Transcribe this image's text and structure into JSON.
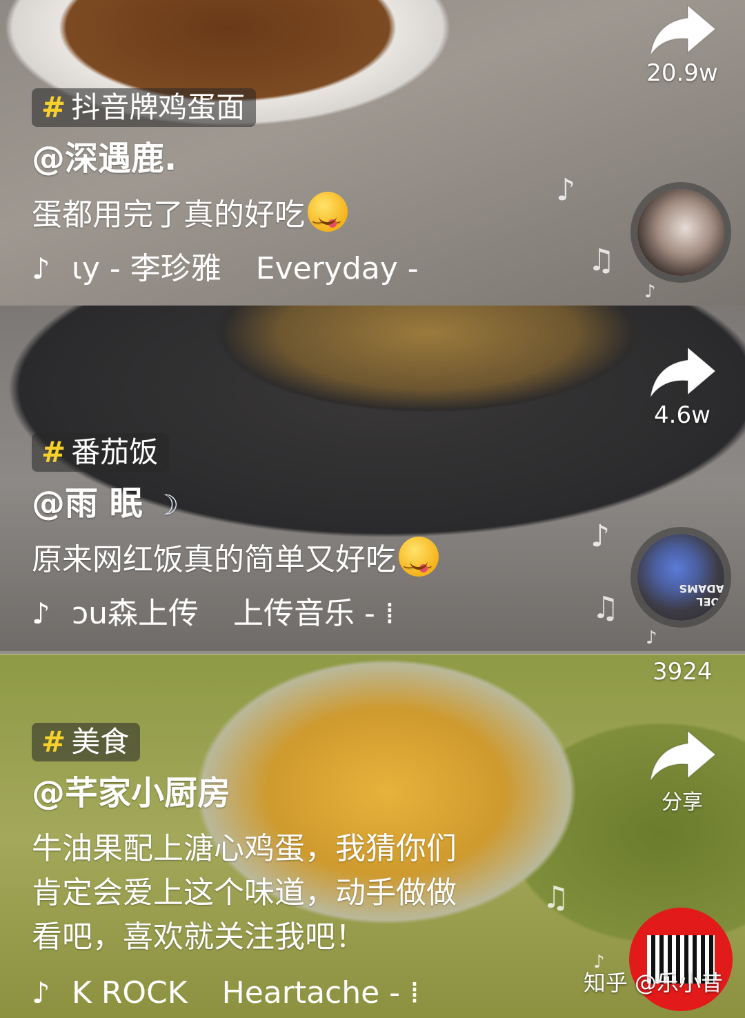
{
  "videos": [
    {
      "hashtag": "抖音牌鸡蛋面",
      "hash_symbol": "#",
      "username": "@深遇鹿.",
      "description": "蛋都用完了真的好吃",
      "music_a": "ιy - 李珍雅",
      "music_b": "Everyday -",
      "share_count": "20.9w",
      "share_icon": "share-arrow-icon",
      "emoji": "yum-face-emoji"
    },
    {
      "hashtag": "番茄饭",
      "hash_symbol": "#",
      "username": "@雨  眠",
      "description": "原来网红饭真的简单又好吃",
      "music_a": "ɔu森上传",
      "music_b": "上传音乐 - ⁞",
      "share_count": "4.6w",
      "share_icon": "share-arrow-icon",
      "emoji": "yum-face-emoji",
      "disc_text": "JOEL ADAMS"
    },
    {
      "side_count": "3924",
      "hashtag": "美食",
      "hash_symbol": "#",
      "username": "@芊家小厨房",
      "description_lines": [
        "牛油果配上溏心鸡蛋，我猜你们",
        "肯定会爱上这个味道，动手做做",
        "看吧，喜欢就关注我吧！"
      ],
      "music_a": "K ROCK",
      "music_b": "Heartache - ⁞",
      "share_label": "分享",
      "share_icon": "share-arrow-icon"
    }
  ],
  "watermark": "知乎 @乐小昔",
  "music_note_glyph": "♪",
  "float_note_glyph": "♫",
  "colors": {
    "hashtag_accent": "#f6d12b",
    "logo_red": "#e21a1a"
  }
}
